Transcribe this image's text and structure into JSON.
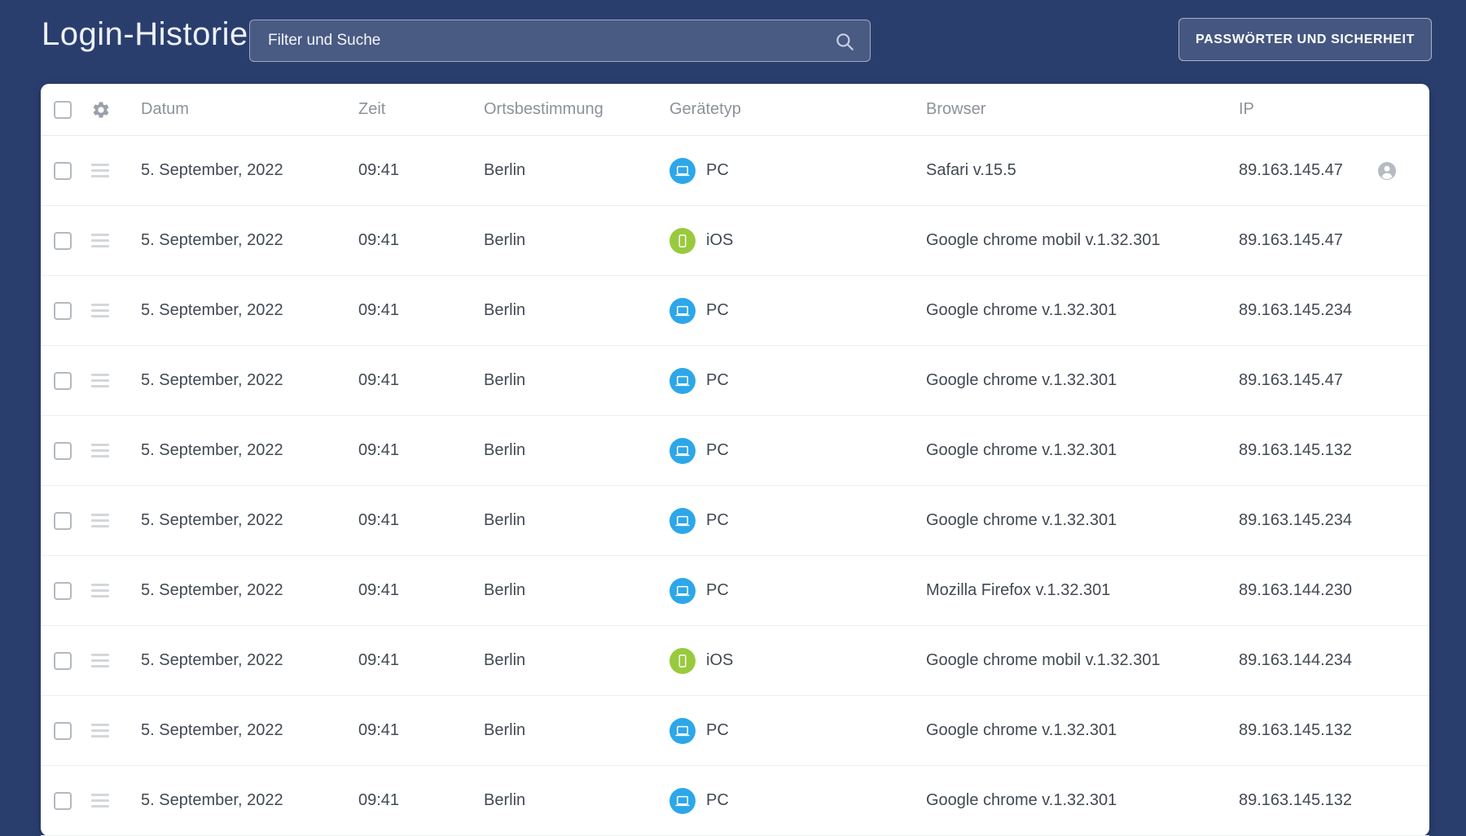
{
  "header": {
    "title": "Login-Historie",
    "search_placeholder": "Filter und Suche",
    "security_button_label": "PASSWÖRTER UND SICHERHEIT"
  },
  "table": {
    "columns": {
      "datum": "Datum",
      "zeit": "Zeit",
      "ortsbestimmung": "Ortsbestimmung",
      "geraetetyp": "Gerätetyp",
      "browser": "Browser",
      "ip": "IP"
    },
    "rows": [
      {
        "datum": "5. September, 2022",
        "zeit": "09:41",
        "ortsbestimmung": "Berlin",
        "geraetetyp": "PC",
        "browser": "Safari v.15.5",
        "ip": "89.163.145.47",
        "user_icon": true
      },
      {
        "datum": "5. September, 2022",
        "zeit": "09:41",
        "ortsbestimmung": "Berlin",
        "geraetetyp": "iOS",
        "browser": "Google chrome mobil  v.1.32.301",
        "ip": "89.163.145.47",
        "user_icon": false
      },
      {
        "datum": "5. September, 2022",
        "zeit": "09:41",
        "ortsbestimmung": "Berlin",
        "geraetetyp": "PC",
        "browser": "Google chrome v.1.32.301",
        "ip": "89.163.145.234",
        "user_icon": false
      },
      {
        "datum": "5. September, 2022",
        "zeit": "09:41",
        "ortsbestimmung": "Berlin",
        "geraetetyp": "PC",
        "browser": "Google chrome v.1.32.301",
        "ip": "89.163.145.47",
        "user_icon": false
      },
      {
        "datum": "5. September, 2022",
        "zeit": "09:41",
        "ortsbestimmung": "Berlin",
        "geraetetyp": "PC",
        "browser": "Google chrome v.1.32.301",
        "ip": "89.163.145.132",
        "user_icon": false
      },
      {
        "datum": "5. September, 2022",
        "zeit": "09:41",
        "ortsbestimmung": "Berlin",
        "geraetetyp": "PC",
        "browser": "Google chrome v.1.32.301",
        "ip": "89.163.145.234",
        "user_icon": false
      },
      {
        "datum": "5. September, 2022",
        "zeit": "09:41",
        "ortsbestimmung": "Berlin",
        "geraetetyp": "PC",
        "browser": "Mozilla Firefox  v.1.32.301",
        "ip": "89.163.144.230",
        "user_icon": false
      },
      {
        "datum": "5. September, 2022",
        "zeit": "09:41",
        "ortsbestimmung": "Berlin",
        "geraetetyp": "iOS",
        "browser": "Google chrome mobil  v.1.32.301",
        "ip": "89.163.144.234",
        "user_icon": false
      },
      {
        "datum": "5. September, 2022",
        "zeit": "09:41",
        "ortsbestimmung": "Berlin",
        "geraetetyp": "PC",
        "browser": "Google chrome v.1.32.301",
        "ip": "89.163.145.132",
        "user_icon": false
      },
      {
        "datum": "5. September, 2022",
        "zeit": "09:41",
        "ortsbestimmung": "Berlin",
        "geraetetyp": "PC",
        "browser": "Google chrome v.1.32.301",
        "ip": "89.163.145.132",
        "user_icon": false
      }
    ]
  },
  "icons": {
    "search": "magnifier-icon",
    "table_settings": "gear-icon",
    "row_handle": "hamburger-icon",
    "device_pc": "laptop-icon",
    "device_ios": "smartphone-icon",
    "session_user": "person-icon"
  },
  "colors": {
    "page_bg": "#2A3E6E",
    "card_bg": "#FFFFFF",
    "pc_badge": "#2DA7E9",
    "ios_badge": "#99CA3D",
    "header_text": "#8B929B",
    "cell_text": "#424954",
    "divider": "#EEEFF1"
  }
}
